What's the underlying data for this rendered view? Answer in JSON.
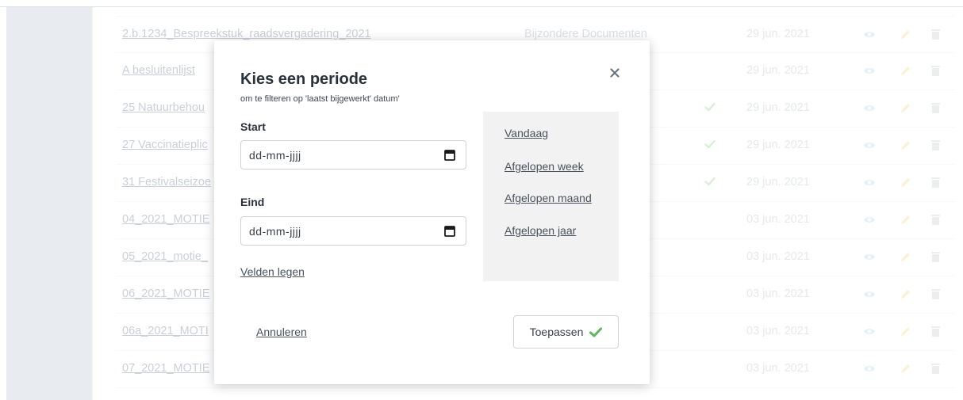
{
  "table": {
    "rows": [
      {
        "name": "2.b.1234_Bespreekstuk_raadsvergadering_2021",
        "category": "Bijzondere Documenten",
        "checked": false,
        "date": "29 jun. 2021"
      },
      {
        "name": "A besluitenlijst",
        "category": "",
        "checked": false,
        "date": "29 jun. 2021"
      },
      {
        "name": "25 Natuurbehou",
        "category": "",
        "checked": true,
        "date": "29 jun. 2021"
      },
      {
        "name": "27 Vaccinatieplic",
        "category": "",
        "checked": true,
        "date": "29 jun. 2021"
      },
      {
        "name": "31 Festivalseizoe",
        "category": "",
        "checked": true,
        "date": "29 jun. 2021"
      },
      {
        "name": "04_2021_MOTIE",
        "category": "",
        "checked": false,
        "date": "03 jun. 2021"
      },
      {
        "name": "05_2021_motie_",
        "category": "",
        "checked": false,
        "date": "03 jun. 2021"
      },
      {
        "name": "06_2021_MOTIE",
        "category": "",
        "checked": false,
        "date": "03 jun. 2021"
      },
      {
        "name": "06a_2021_MOTI",
        "category": "",
        "checked": false,
        "date": "03 jun. 2021"
      },
      {
        "name": "07_2021_MOTIE",
        "category": "",
        "checked": false,
        "date": "03 jun. 2021"
      }
    ]
  },
  "modal": {
    "title": "Kies een periode",
    "subtitle": "om te filteren op 'laatst bijgewerkt' datum'",
    "start_label": "Start",
    "start_placeholder": "dd-mm-jjjj",
    "end_label": "Eind",
    "end_placeholder": "dd-mm-jjjj",
    "clear_label": "Velden legen",
    "presets": [
      "Vandaag",
      "Afgelopen week",
      "Afgelopen maand",
      "Afgelopen jaar"
    ],
    "cancel_label": "Annuleren",
    "apply_label": "Toepassen"
  },
  "colors": {
    "accent_green": "#5cb85c",
    "sidebar": "#ccd5de"
  },
  "icons": [
    "eye-icon",
    "pencil-icon",
    "trash-icon",
    "check-icon",
    "close-icon",
    "calendar-icon"
  ]
}
